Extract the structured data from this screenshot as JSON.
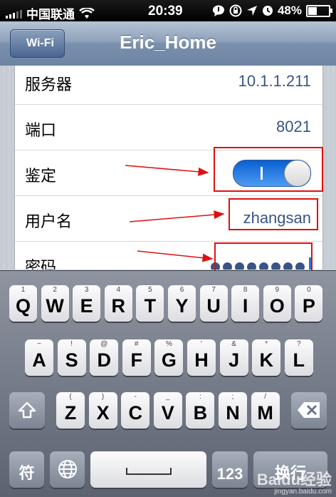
{
  "status_bar": {
    "carrier": "中国联通",
    "time": "20:39",
    "battery": "48%",
    "battery_level": 0.48,
    "icons": [
      "signal-icon",
      "wifi-icon",
      "chat-bubble-icon",
      "rotation-lock-icon",
      "location-arrow-icon",
      "alarm-clock-icon",
      "battery-icon"
    ]
  },
  "nav": {
    "back_label": "Wi-Fi",
    "title": "Eric_Home"
  },
  "settings": {
    "rows": [
      {
        "label": "服务器",
        "value": "10.1.1.211"
      },
      {
        "label": "端口",
        "value": "8021"
      },
      {
        "label": "鉴定",
        "toggle_on": true
      },
      {
        "label": "用户名",
        "value": "zhangsan"
      },
      {
        "label": "密码",
        "masked_length": 8
      }
    ]
  },
  "annotation_color": "#e01010",
  "keyboard": {
    "row1": [
      {
        "key": "Q",
        "sup": "1"
      },
      {
        "key": "W",
        "sup": "2"
      },
      {
        "key": "E",
        "sup": "3"
      },
      {
        "key": "R",
        "sup": "4"
      },
      {
        "key": "T",
        "sup": "5"
      },
      {
        "key": "Y",
        "sup": "6"
      },
      {
        "key": "U",
        "sup": "7"
      },
      {
        "key": "I",
        "sup": "8"
      },
      {
        "key": "O",
        "sup": "9"
      },
      {
        "key": "P",
        "sup": "0"
      }
    ],
    "row2": [
      {
        "key": "A",
        "sup": "~"
      },
      {
        "key": "S",
        "sup": "!"
      },
      {
        "key": "D",
        "sup": "@"
      },
      {
        "key": "F",
        "sup": "#"
      },
      {
        "key": "G",
        "sup": "%"
      },
      {
        "key": "H",
        "sup": "'"
      },
      {
        "key": "J",
        "sup": "&"
      },
      {
        "key": "K",
        "sup": "*"
      },
      {
        "key": "L",
        "sup": "?"
      }
    ],
    "row3": [
      {
        "key": "Z",
        "sup": "("
      },
      {
        "key": "X",
        "sup": ")"
      },
      {
        "key": "C",
        "sup": "-"
      },
      {
        "key": "V",
        "sup": "_"
      },
      {
        "key": "B",
        "sup": ":"
      },
      {
        "key": "N",
        "sup": ";"
      },
      {
        "key": "M",
        "sup": "/"
      }
    ],
    "symbol_key": "符",
    "numbers_key": "123",
    "return_key": "换行",
    "shift_icon": "shift-icon",
    "delete_icon": "delete-icon",
    "globe_icon": "globe-icon",
    "space_icon": "space-icon"
  },
  "watermark": {
    "brand": "Baidu经验",
    "url": "jingyan.baidu.com"
  }
}
